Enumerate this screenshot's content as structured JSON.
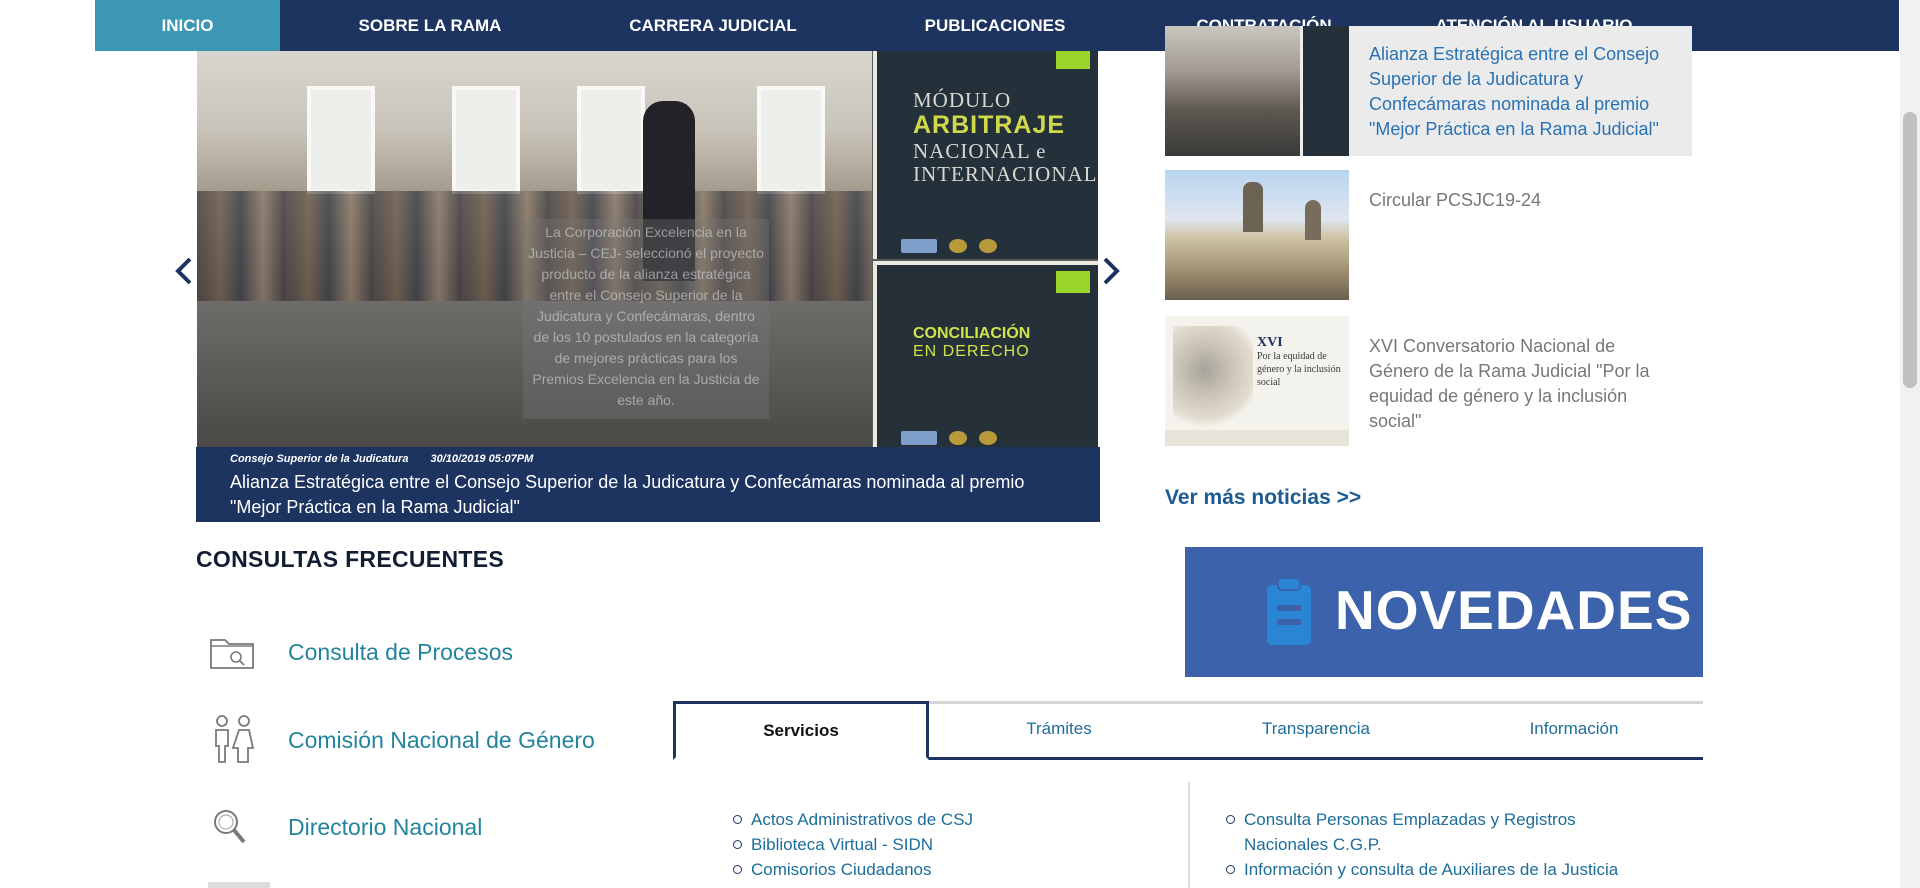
{
  "nav": {
    "items": [
      {
        "label": "INICIO"
      },
      {
        "label": "SOBRE LA RAMA"
      },
      {
        "label": "CARRERA JUDICIAL"
      },
      {
        "label": "PUBLICACIONES"
      },
      {
        "label": "CONTRATACIÓN"
      },
      {
        "label": "ATENCIÓN AL USUARIO"
      }
    ],
    "active_index": 0
  },
  "slider": {
    "caption": "La Corporación Excelencia en la Justicia – CEJ- seleccionó el proyecto producto de la alianza estratégica entre el Consejo Superior de la Judicatura y Confecámaras, dentro de los 10 postulados en la categoría de mejores prácticas para los Premios Excelencia en la Justicia de este año.",
    "book1_line1": "MÓDULO",
    "book1_line2": "ARBITRAJE",
    "book1_line3": "NACIONAL e",
    "book1_line4": "INTERNACIONAL",
    "book2_line1": "CONCILIACIÓN",
    "book2_line2": "EN DERECHO",
    "prev_icon": "chevron-left-icon",
    "next_icon": "chevron-right-icon"
  },
  "featured_news": {
    "source": "Consejo Superior de la Judicatura",
    "date": "30/10/2019 05:07PM",
    "headline": "Alianza Estratégica entre el Consejo Superior de la Judicatura y Confecámaras nominada al premio \"Mejor Práctica en la Rama Judicial\""
  },
  "side_news": [
    {
      "title": "Alianza Estratégica entre el Consejo Superior de la Judicatura y Confecámaras nominada al premio \"Mejor Práctica en la Rama Judicial\"",
      "color": "#2a72b5"
    },
    {
      "title": "Circular PCSJC19-24",
      "color": "#777777"
    },
    {
      "title": "XVI Conversatorio Nacional de Género de la Rama Judicial \"Por la equidad de género y la inclusión social\"",
      "color": "#777777",
      "thumb_title": "XVI",
      "thumb_sub": "Por la equidad de género y la inclusión social"
    }
  ],
  "more_news": "Ver más noticias >>",
  "consultas": {
    "title": "CONSULTAS FRECUENTES",
    "items": [
      {
        "label": "Consulta de Procesos",
        "icon": "folder-search-icon"
      },
      {
        "label": "Comisión Nacional de Género",
        "icon": "gender-people-icon"
      },
      {
        "label": "Directorio Nacional",
        "icon": "magnifier-icon"
      }
    ]
  },
  "novedades": {
    "label": "NOVEDADES",
    "icon": "clipboard-icon",
    "color": "#3b62aa"
  },
  "tabs": {
    "items": [
      {
        "label": "Servicios"
      },
      {
        "label": "Trámites"
      },
      {
        "label": "Transparencia"
      },
      {
        "label": "Información"
      }
    ],
    "active_index": 0
  },
  "services_left": [
    "Actos Administrativos de CSJ",
    "Biblioteca Virtual - SIDN",
    "Comisorios Ciudadanos"
  ],
  "services_right": [
    "Consulta Personas Emplazadas y Registros Nacionales C.G.P.",
    "Información y consulta de Auxiliares de la Justicia"
  ],
  "colors": {
    "nav_bg": "#1d3461",
    "nav_active": "#3b97b3",
    "link": "#1d6d9a",
    "consulta_link": "#23849e"
  }
}
